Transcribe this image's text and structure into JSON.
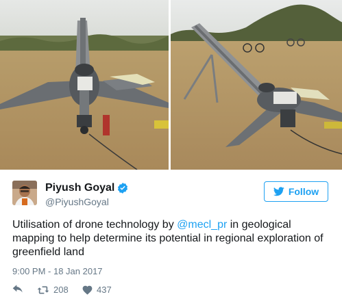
{
  "tweet": {
    "author": {
      "name": "Piyush Goyal",
      "handle": "@PiyushGoyal",
      "verified": true
    },
    "follow_label": "Follow",
    "text": {
      "part1": "Utilisation of drone technology by ",
      "mention": "@mecl_pr",
      "part2": " in geological mapping to help determine its potential in regional exploration of greenfield land"
    },
    "timestamp": "9:00 PM - 18 Jan 2017",
    "stats": {
      "retweets": "208",
      "likes": "437"
    },
    "media": {
      "photos": [
        "drone-on-launcher-front",
        "drone-on-launcher-side"
      ]
    }
  },
  "colors": {
    "accent": "#1da1f2",
    "secondary_text": "#657786",
    "primary_text": "#14171a"
  },
  "icons": [
    "verified-icon",
    "twitter-bird-icon",
    "reply-icon",
    "retweet-icon",
    "like-heart-icon"
  ]
}
